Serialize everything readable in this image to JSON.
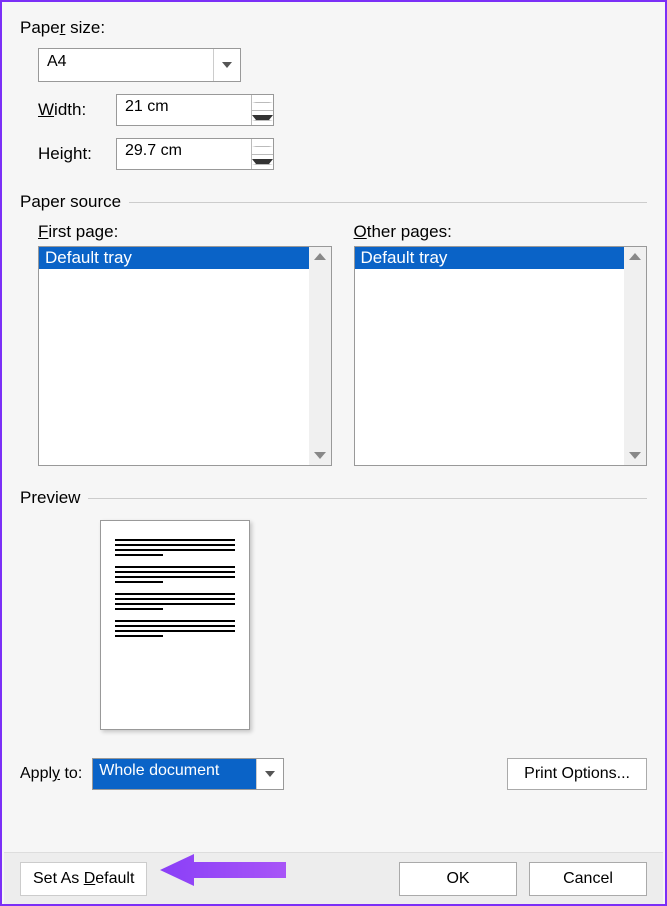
{
  "paper_size": {
    "label_pre": "Pape",
    "label_u": "r",
    "label_post": " size:",
    "value": "A4",
    "width_label_u": "W",
    "width_label_post": "idth:",
    "width_value": "21 cm",
    "height_label_pre": "Hei",
    "height_label_u": "g",
    "height_label_post": "ht:",
    "height_value": "29.7 cm"
  },
  "paper_source": {
    "heading": "Paper source",
    "first_page_label_u": "F",
    "first_page_label_post": "irst page:",
    "first_page_value": "Default tray",
    "other_pages_label_u": "O",
    "other_pages_label_post": "ther pages:",
    "other_pages_value": "Default tray"
  },
  "preview": {
    "heading": "Preview"
  },
  "apply": {
    "label_pre": "Appl",
    "label_u": "y",
    "label_post": " to:",
    "value": "Whole document",
    "print_options_label": "Print Options..."
  },
  "footer": {
    "set_default_pre": "Set As ",
    "set_default_u": "D",
    "set_default_post": "efault",
    "ok": "OK",
    "cancel": "Cancel"
  }
}
